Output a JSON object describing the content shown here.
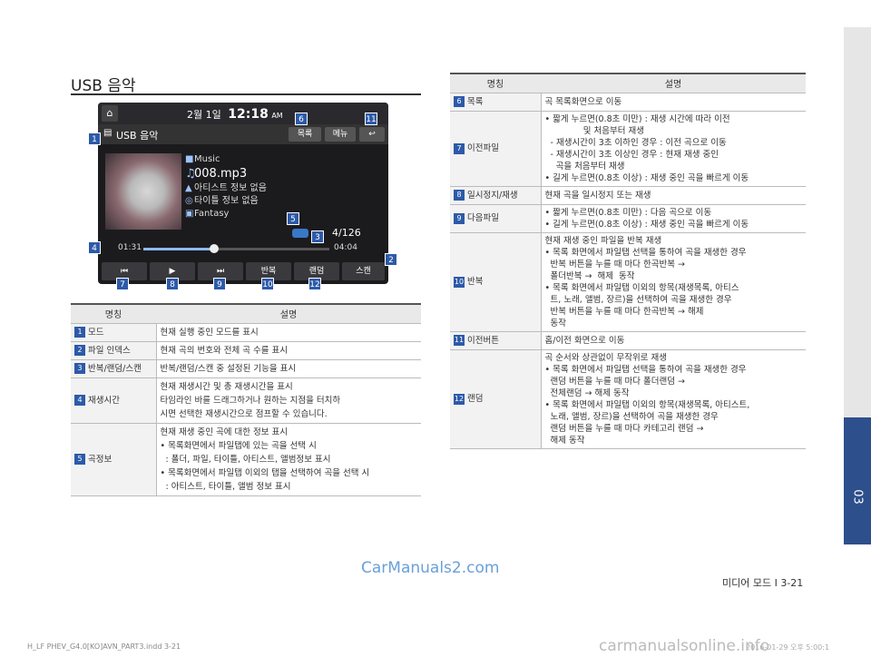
{
  "section_title": "USB 음악",
  "screen": {
    "day": "2월",
    "hour": "1일",
    "time": "12:18",
    "ampm": "AM",
    "title": "USB 음악",
    "btn_list": "목록",
    "btn_menu": "메뉴",
    "back_icon": "back-arrow-icon",
    "folder": "Music",
    "file": "008.mp3",
    "artist": "아티스트 정보 없음",
    "track_title": "타이틀 정보 없음",
    "album": "Fantasy",
    "track_index": "4/126",
    "time_start": "01:31",
    "time_end": "04:04",
    "progress": 0.38,
    "ctrl_prev": "⏮",
    "ctrl_play": "▶",
    "ctrl_next": "⏭",
    "ctrl_repeat": "반복",
    "ctrl_random": "랜덤",
    "ctrl_scan": "스캔"
  },
  "left_table": {
    "head_name": "명칭",
    "head_desc": "설명",
    "rows": [
      {
        "num": "1",
        "name": "모드",
        "lines": [
          "현재 실행 중인 모드를 표시"
        ]
      },
      {
        "num": "2",
        "name": "파일 인덱스",
        "lines": [
          "현재 곡의 번호와 전체 곡 수를 표시"
        ]
      },
      {
        "num": "3",
        "name": "반복/랜덤/스캔",
        "lines": [
          "반복/랜덤/스캔 중 설정된 기능을 표시"
        ]
      },
      {
        "num": "4",
        "name": "재생시간",
        "lines": [
          "현재 재생시간 및 총 재생시간을 표시",
          "타임라인 바를 드래그하거나 원하는 지점을 터치하",
          "시면 선택한 재생시간으로 점프할 수 있습니다."
        ]
      },
      {
        "num": "5",
        "name": "곡정보",
        "lines": [
          "현재 재생 중인 곡에 대한 정보 표시",
          "• 목록화면에서 파일탭에 있는 곡을 선택 시",
          "  : 폴더, 파일, 타이틀, 아티스트, 앨범정보 표시",
          "• 목록화면에서 파일탭 이외의 탭을 선택하여 곡을 선택 시",
          "  : 아티스트, 타이틀, 앨범 정보 표시"
        ]
      }
    ]
  },
  "right_table": {
    "head_name": "명칭",
    "head_desc": "설명",
    "rows": [
      {
        "num": "6",
        "name": "목록",
        "lines": [
          "곡 목록화면으로 이동"
        ]
      },
      {
        "num": "7",
        "name": "이전파일",
        "lines": [
          "• 짧게 누르면(0.8초 미만) : 재생 시간에 따라 이전",
          "              및 처음부터 재생",
          "  - 재생시간이 3초 이하인 경우 : 이전 곡으로 이동",
          "  - 재생시간이 3초 이상인 경우 : 현재 재생 중인",
          "    곡을 처음부터 재생",
          "• 길게 누르면(0.8초 이상) : 재생 중인 곡을 빠르게 이동"
        ]
      },
      {
        "num": "8",
        "name": "일시정지/재생",
        "lines": [
          "현재 곡을 일시정지 또는 재생"
        ]
      },
      {
        "num": "9",
        "name": "다음파일",
        "lines": [
          "• 짧게 누르면(0.8초 미만) : 다음 곡으로 이동",
          "• 길게 누르면(0.8초 이상) : 재생 중인 곡을 빠르게 이동"
        ]
      },
      {
        "num": "10",
        "name": "반복",
        "lines": [
          "현재 재생 중인 파일을 반복 재생",
          "• 목록 화면에서 파일탭 선택을 통하여 곡을 재생한 경우",
          "  반복 버튼을 누를 때 마다 한곡반복 → ",
          "  폴더반복 →  해제  동작",
          "• 목록 화면에서 파일탭 이외의 항목(재생목록, 아티스",
          "  트, 노래, 앨범, 장르)을 선택하여 곡을 재생한 경우",
          "  반복 버튼을 누를 때 마다 한곡반복 → 해제",
          "  동작"
        ]
      },
      {
        "num": "11",
        "name": "이전버튼",
        "lines": [
          "홈/이전 화면으로 이동"
        ]
      },
      {
        "num": "12",
        "name": "랜덤",
        "lines": [
          "곡 순서와 상관없이 무작위로 재생",
          "• 목록 화면에서 파일탭 선택을 통하여 곡을 재생한 경우",
          "  랜덤 버튼을 누를 때 마다 폴더랜덤 →",
          "  전체랜덤 → 해제 동작",
          "• 목록 화면에서 파일탭 이외의 항목(재생목록, 아티스트,",
          "  노래, 앨범, 장르)을 선택하여 곡을 재생한 경우",
          "  랜덤 버튼을 누를 때 마다 카테고리 랜덤 →",
          "  해제 동작"
        ]
      }
    ]
  },
  "footer": "미디어 모드 I 3-21",
  "chapter_tab": "03",
  "watermark": "CarManuals2.com",
  "watermark2": "carmanualsonline.info",
  "slug": "H_LF PHEV_G4.0[KO]AVN_PART3.indd   3-21",
  "slug_date": "2016-01-29   오후 5:00:1"
}
